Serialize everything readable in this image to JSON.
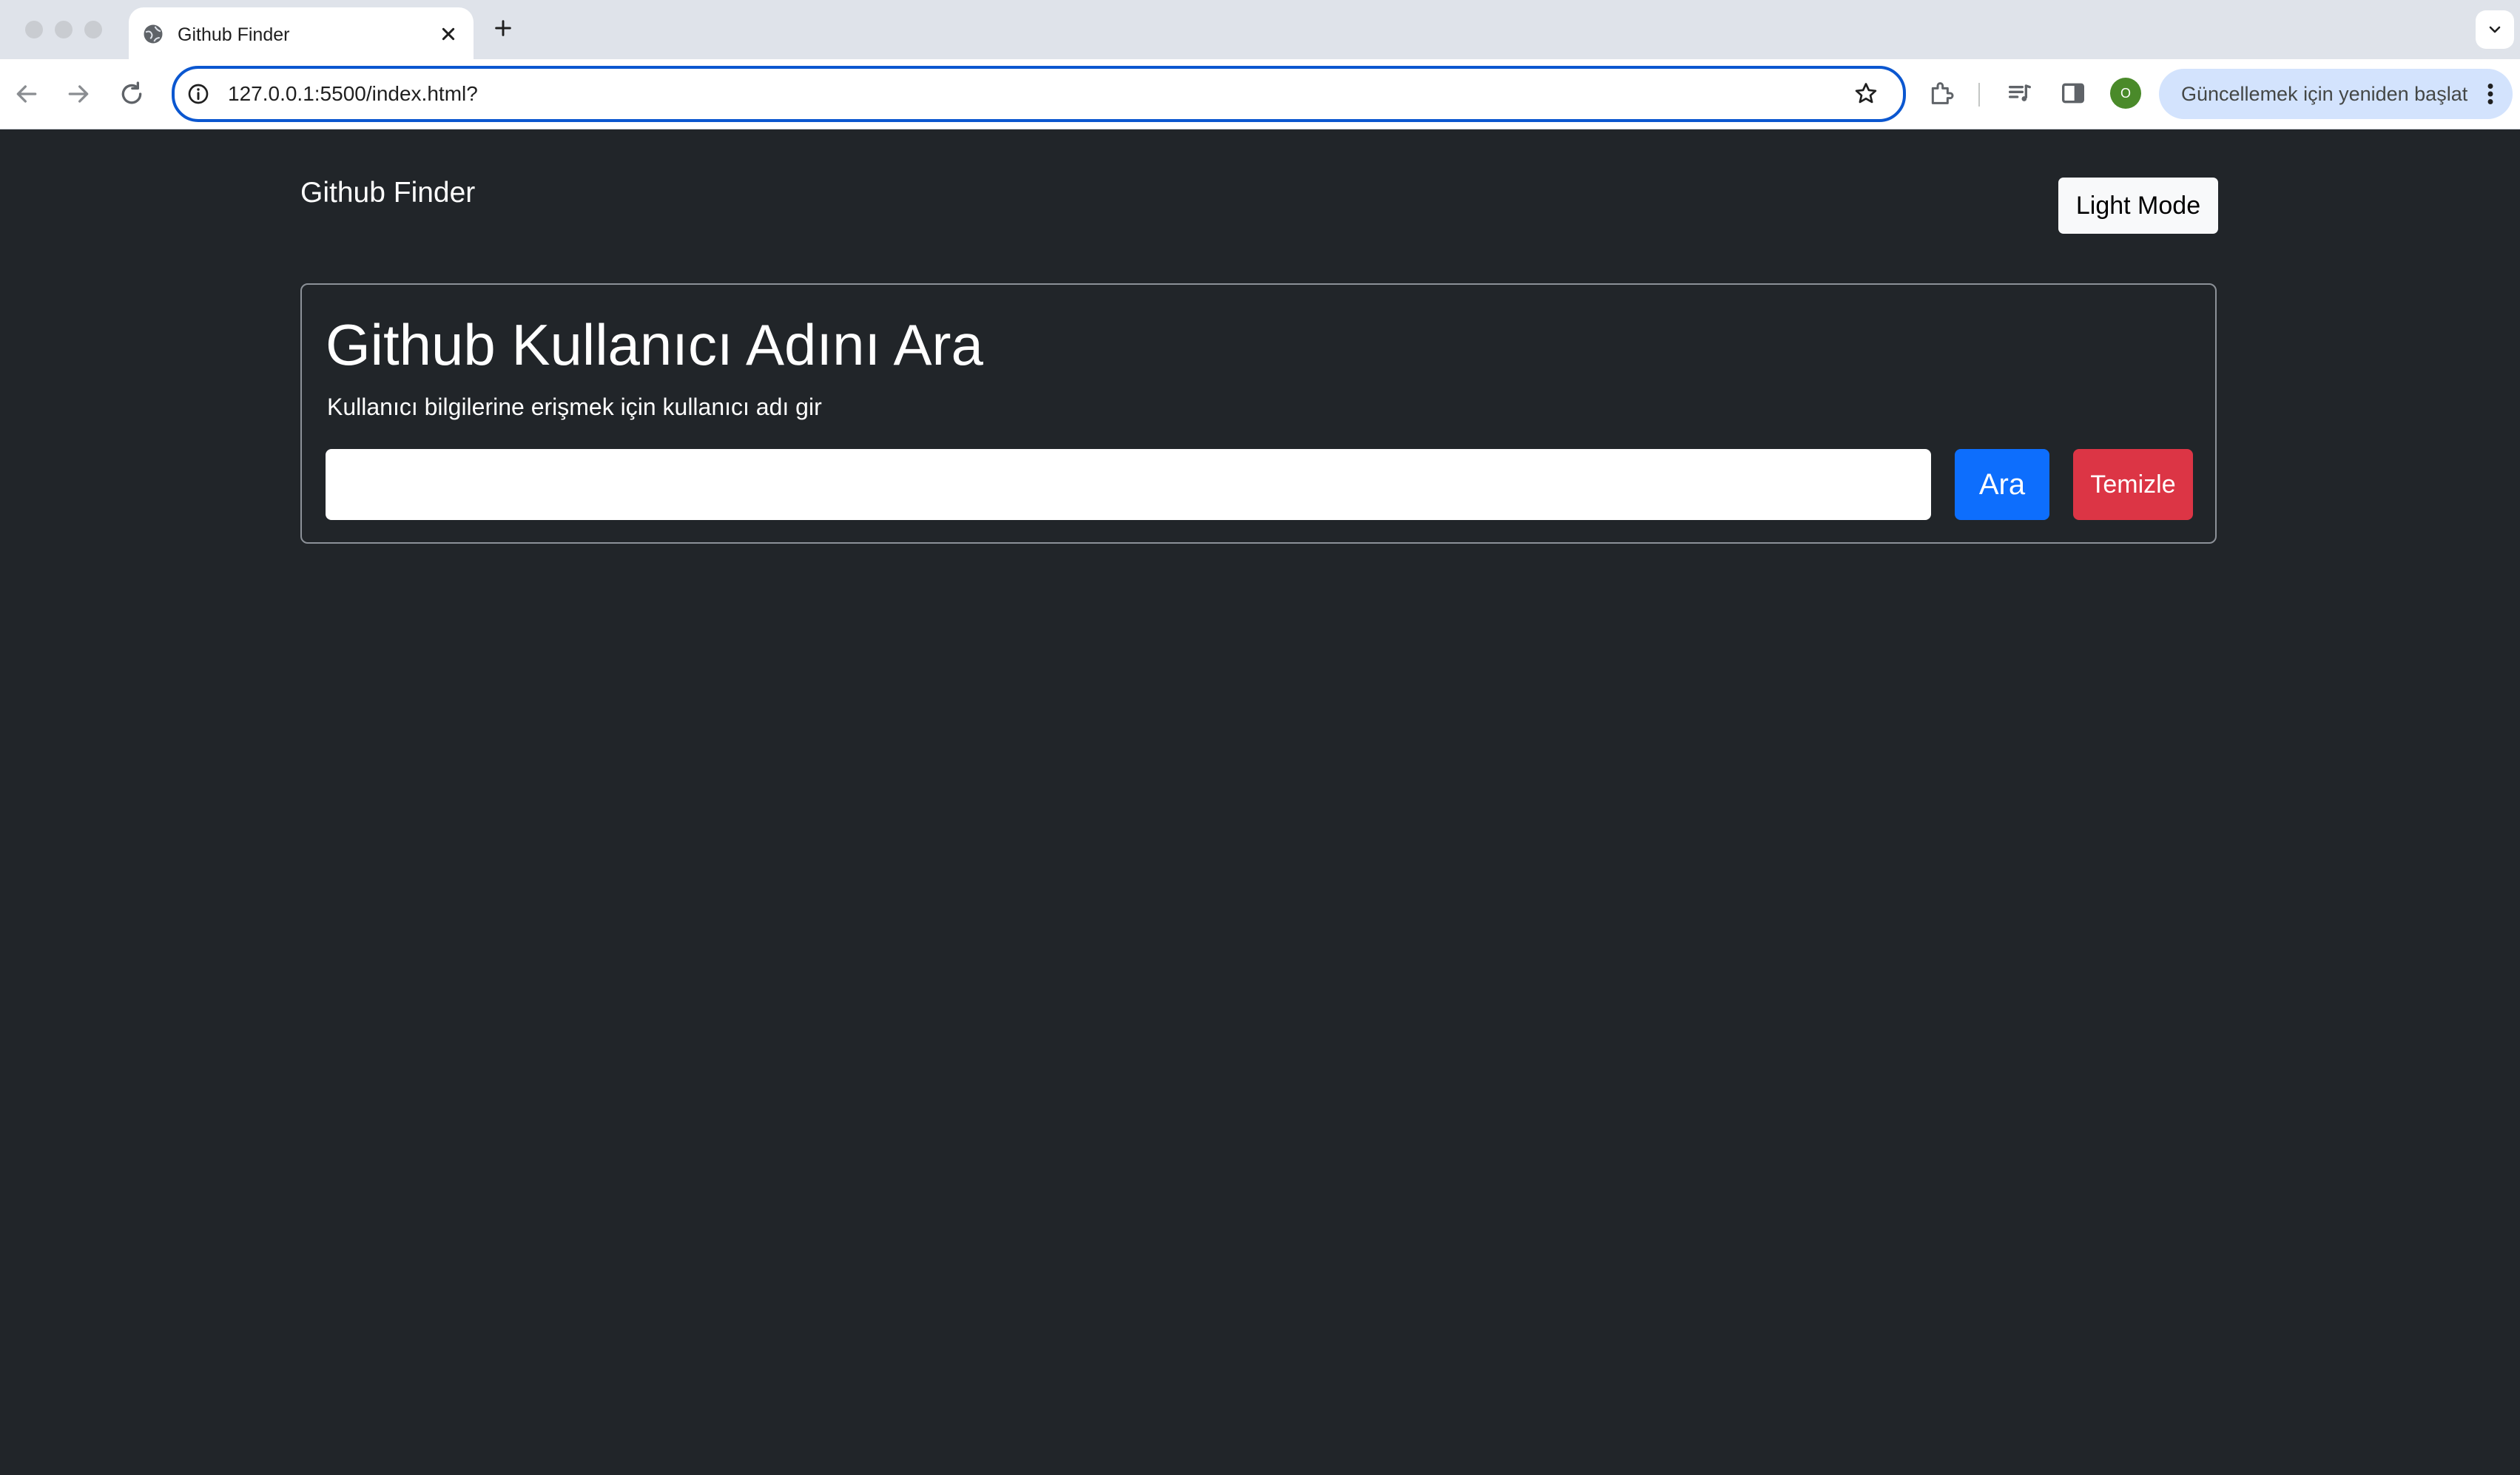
{
  "browser": {
    "tab": {
      "title": "Github Finder"
    },
    "address_bar": {
      "url": "127.0.0.1:5500/index.html?"
    },
    "profile_initial": "O",
    "update_button_label": "Güncellemek için yeniden başlat",
    "icons": {
      "tab": "globe-icon",
      "close": "close-icon",
      "new_tab": "plus-icon",
      "tab_search": "chevron-down-icon",
      "back": "arrow-left-icon",
      "forward": "arrow-right-icon",
      "reload": "reload-icon",
      "site_info": "info-icon",
      "bookmark": "star-icon",
      "extensions": "puzzle-icon",
      "media": "media-control-icon",
      "side_panel": "side-panel-icon",
      "menu": "kebab-menu-icon"
    }
  },
  "app": {
    "brand": "Github Finder",
    "mode_toggle_label": "Light Mode",
    "search_card": {
      "title": "Github Kullanıcı Adını Ara",
      "subtitle": "Kullanıcı bilgilerine erişmek için kullanıcı adı gir",
      "input_value": "",
      "search_button_label": "Ara",
      "clear_button_label": "Temizle"
    }
  },
  "colors": {
    "page_background": "#212529",
    "primary": "#0d6efd",
    "danger": "#dc3545",
    "light_button": "#f8f9fa",
    "omnibox_focus": "#0b57d0",
    "update_button": "#d3e3fd"
  }
}
